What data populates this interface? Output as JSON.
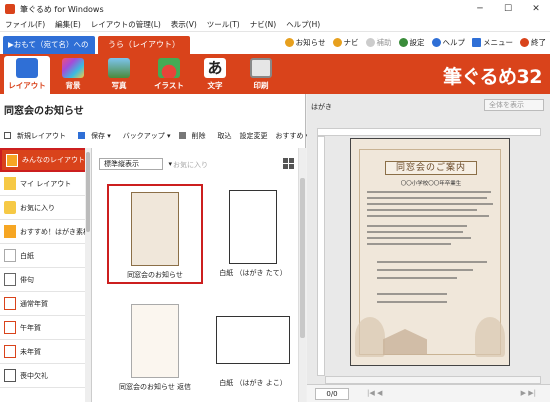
{
  "window": {
    "title": "筆ぐるめ for Windows"
  },
  "menu": [
    "ファイル(F)",
    "編集(E)",
    "レイアウトの管理(L)",
    "表示(V)",
    "ツール(T)",
    "ナビ(N)",
    "ヘルプ(H)"
  ],
  "tabs": {
    "front": "▶おもて（宛て名）への切",
    "back": "うら（レイアウト）"
  },
  "toplinks": [
    {
      "label": "お知らせ",
      "color": "#e7a01e"
    },
    {
      "label": "ナビ",
      "color": "#e7a01e"
    },
    {
      "label": "補助",
      "color": "#bbbbbb"
    },
    {
      "label": "設定",
      "color": "#3a8c3a"
    },
    {
      "label": "ヘルプ",
      "color": "#2f6fd6"
    },
    {
      "label": "メニュー",
      "color": "#2f6fd6"
    },
    {
      "label": "終了",
      "color": "#d9431b"
    }
  ],
  "ribbon": {
    "buttons": [
      {
        "label": "レイアウト",
        "icon": "layout-icon",
        "color": "#2f6fd6"
      },
      {
        "label": "背景",
        "icon": "background-icon",
        "color": "#a54bd8"
      },
      {
        "label": "写真",
        "icon": "photo-icon",
        "color": "#55a0dd"
      },
      {
        "label": "イラスト",
        "icon": "illustration-icon",
        "color": "#44aa55"
      },
      {
        "label": "文字",
        "icon": "text-icon",
        "color": "#333333"
      },
      {
        "label": "印刷",
        "icon": "printer-icon",
        "color": "#cccccc"
      }
    ],
    "brand": "筆ぐるめ32"
  },
  "left": {
    "heading": "同窓会のお知らせ",
    "toolbar": [
      "新規レイアウト",
      "保存 ▾",
      "バックアップ ▾",
      "削除",
      "取込",
      "設定変更",
      "おすすめ ▾"
    ],
    "categories": [
      "みんなのレイアウト",
      "マイ レイアウト",
      "お気に入り",
      "おすすめ！はがき素材",
      "白紙",
      "俳句",
      "通常年賀",
      "午年賀",
      "未年賀",
      "喪中欠礼"
    ],
    "view_select": "標準縦表示",
    "favorite_label": "お気に入り",
    "thumbnails": [
      "同窓会のお知らせ",
      "白紙 （はがき たて）",
      "同窓会のお知らせ 返信",
      "白紙 （はがき よこ）"
    ]
  },
  "right": {
    "label": "はがき",
    "zoom": "全体を表示",
    "preview": {
      "title": "同窓会のご案内",
      "subtitle": "〇〇小学校〇〇年卒業生"
    },
    "page": "0/0"
  }
}
